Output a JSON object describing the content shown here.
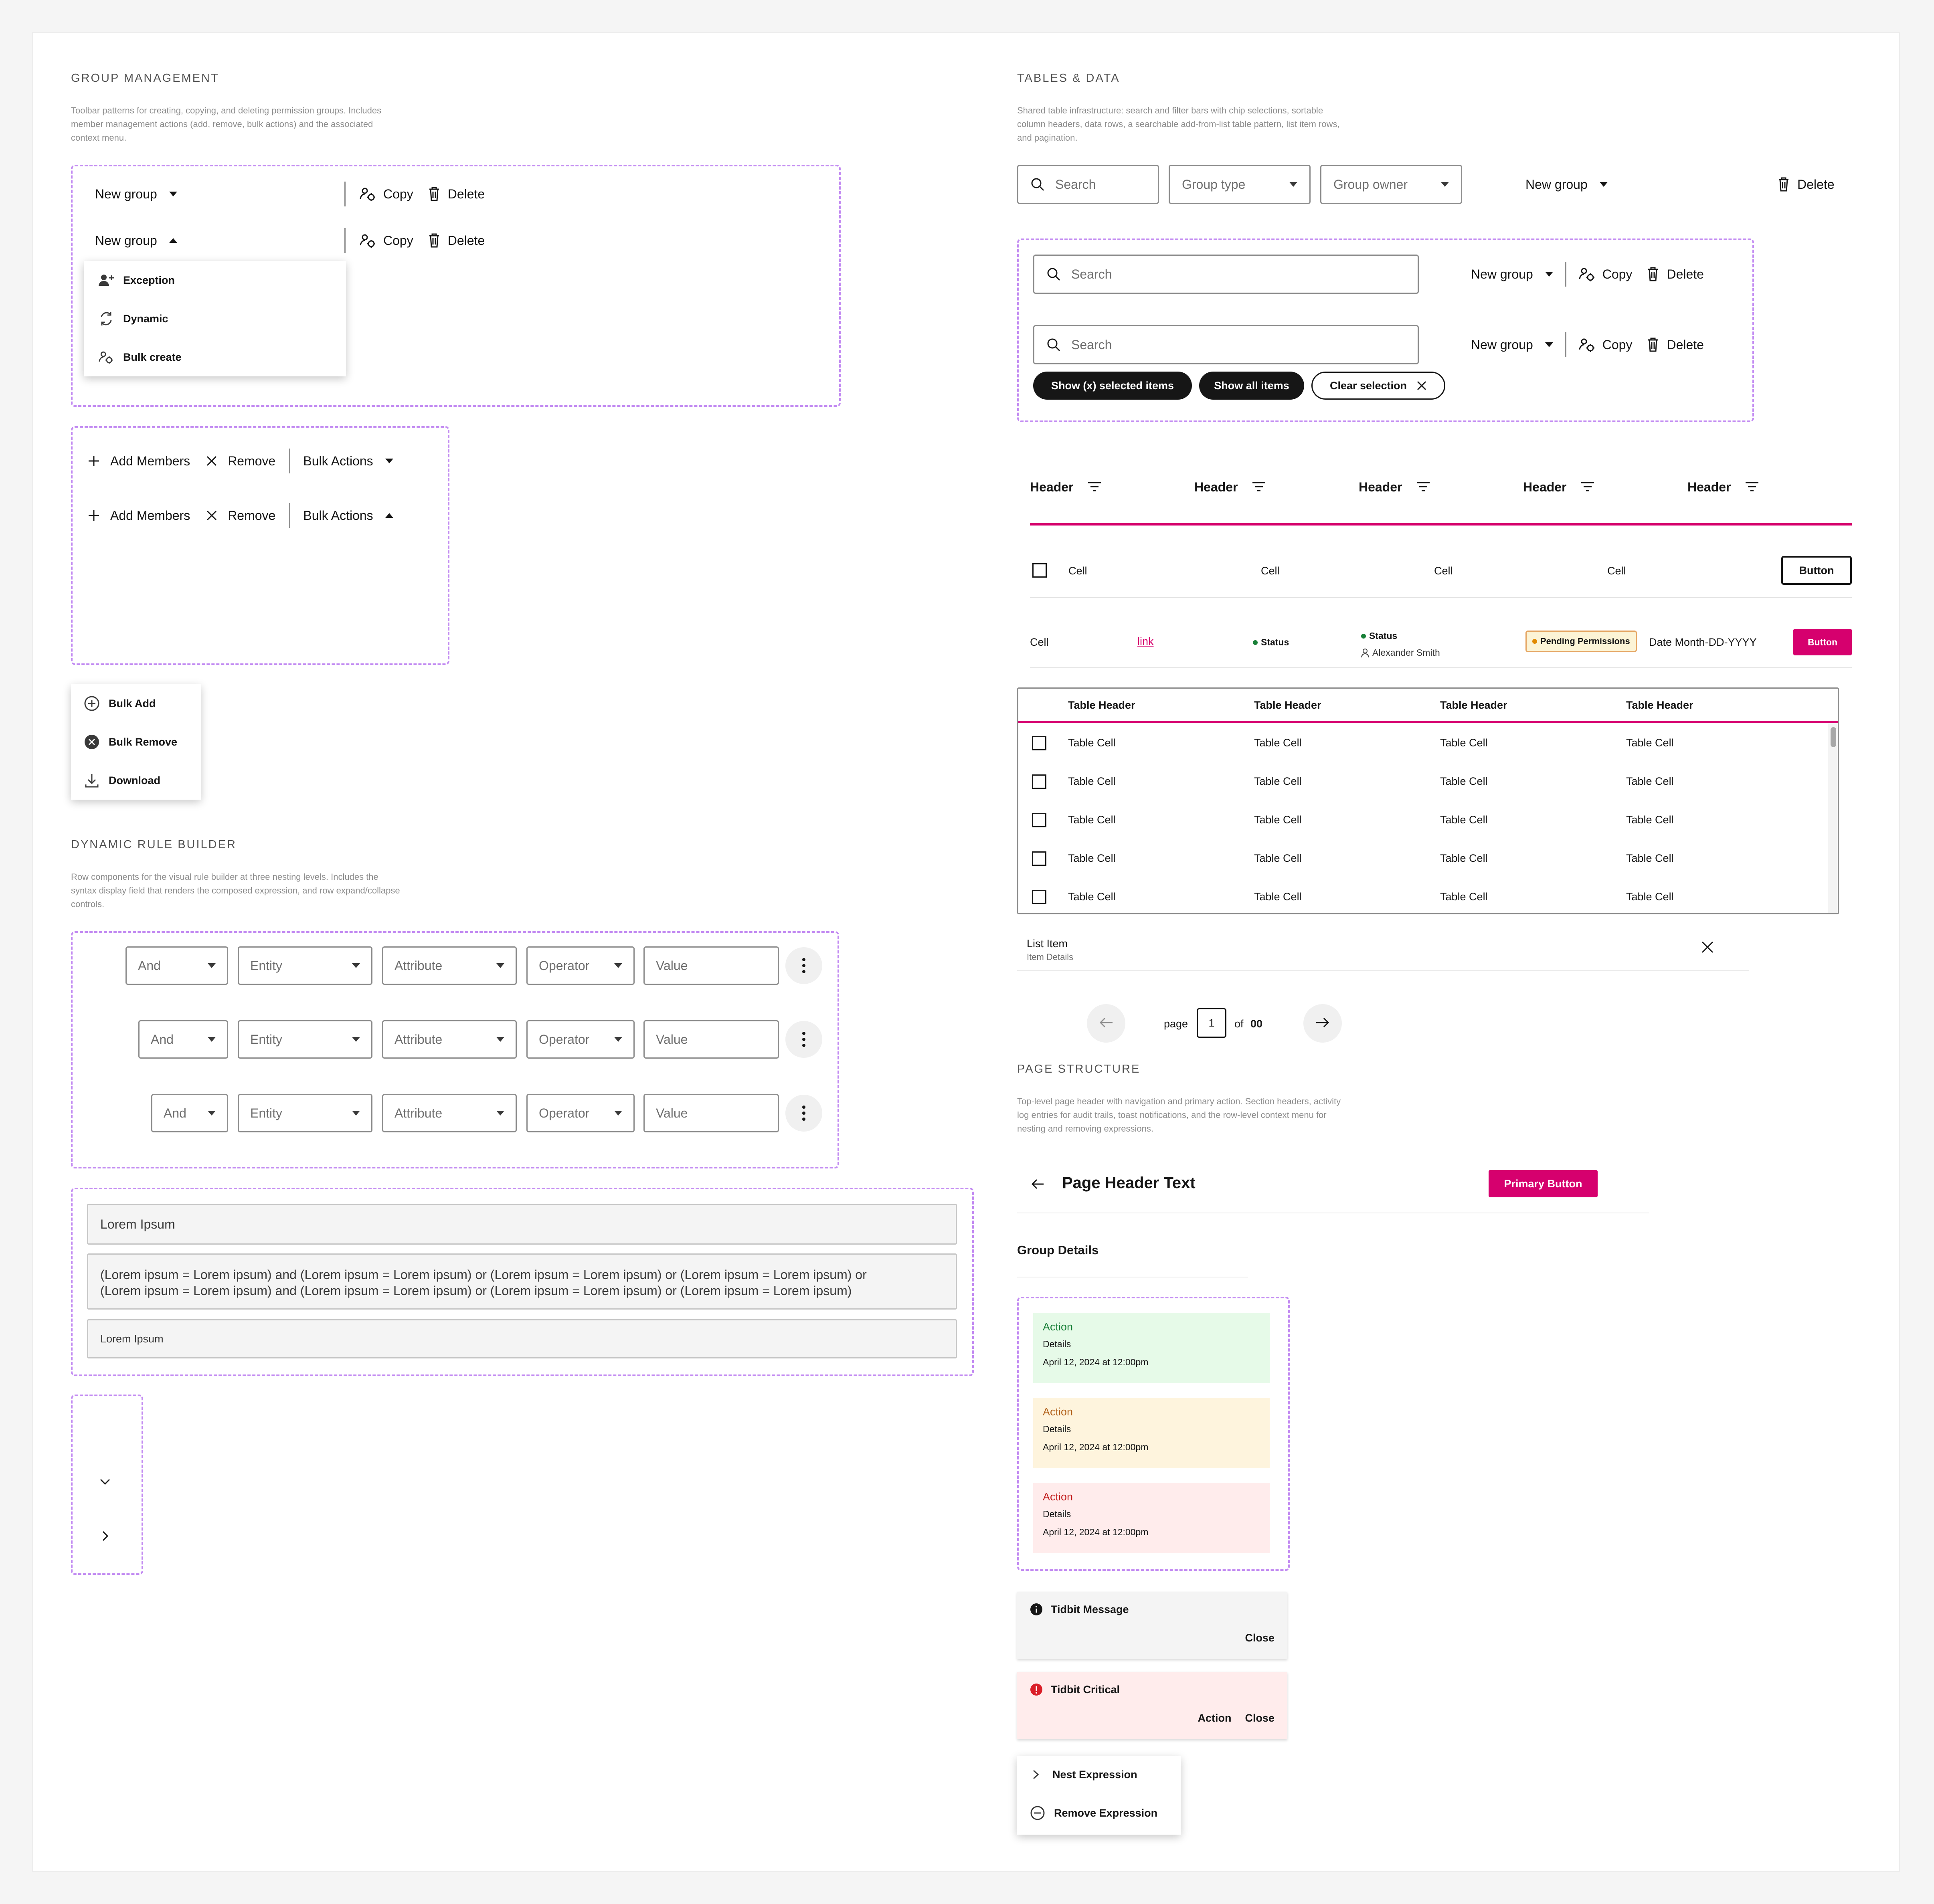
{
  "group_management": {
    "title": "GROUP MANAGEMENT",
    "desc_lines": [
      "Toolbar patterns for creating, copying, and deleting permission groups. Includes",
      "member management actions (add, remove, bulk actions) and the associated",
      "context menu."
    ],
    "new_group": "New group",
    "copy": "Copy",
    "delete": "Delete",
    "menu": [
      "Exception",
      "Dynamic",
      "Bulk create"
    ],
    "add_members": "Add Members",
    "remove": "Remove",
    "bulk_actions": "Bulk Actions",
    "bulk_menu": [
      "Bulk Add",
      "Bulk Remove",
      "Download"
    ]
  },
  "rule_builder": {
    "title": "DYNAMIC RULE BUILDER",
    "desc_lines": [
      "Row components for the visual rule builder at three nesting levels. Includes the",
      "syntax display field that renders the composed expression, and row expand/collapse",
      "controls."
    ],
    "and": "And",
    "entity": "Entity",
    "attribute": "Attribute",
    "operator": "Operator",
    "value": "Value",
    "syntax_title": "Lorem Ipsum",
    "syntax_line1": "(Lorem ipsum = Lorem ipsum) and (Lorem ipsum = Lorem ipsum) or (Lorem ipsum = Lorem ipsum) or (Lorem ipsum = Lorem ipsum)  or",
    "syntax_line2": "(Lorem ipsum = Lorem ipsum) and (Lorem ipsum = Lorem ipsum) or (Lorem ipsum = Lorem ipsum) or (Lorem ipsum = Lorem ipsum)",
    "syntax_small": "Lorem Ipsum"
  },
  "tables": {
    "title": "TABLES & DATA",
    "desc_lines": [
      "Shared table infrastructure: search and filter bars with chip selections, sortable",
      "column headers, data rows, a searchable add-from-list table pattern, list item rows,",
      "and pagination."
    ],
    "search": "Search",
    "group_type": "Group type",
    "group_owner": "Group owner",
    "new_group": "New group",
    "copy": "Copy",
    "delete": "Delete",
    "chip_selected": "Show (x) selected items",
    "chip_all": "Show all items",
    "chip_clear": "Clear selection",
    "header": "Header",
    "cell": "Cell",
    "button": "Button",
    "link": "link",
    "status": "Status",
    "person": "Alexander Smith",
    "pending": "Pending Permissions",
    "date": "Date Month-DD-YYYY",
    "table_header": "Table Header",
    "table_cell": "Table Cell",
    "list_item": "List Item",
    "item_details": "Item Details",
    "page_label": "page",
    "page_value": "1",
    "of_label": "of",
    "total_pages": "00",
    "colors": {
      "accent": "#d6006e",
      "status_green": "#198038",
      "pending_bg": "#fcf4d6",
      "pending_border": "#e5a663"
    }
  },
  "page_structure": {
    "title": "PAGE STRUCTURE",
    "desc_lines": [
      "Top-level page header with navigation and primary action. Section headers, activity",
      "log entries for audit trails, toast notifications, and the row-level context menu for",
      "nesting and removing expressions."
    ],
    "page_header": "Page Header Text",
    "primary_button": "Primary Button",
    "group_details": "Group Details",
    "activity": [
      {
        "action": "Action",
        "details": "Details",
        "time": "April 12, 2024 at 12:00pm",
        "bg": "#e6fae8",
        "fg": "#198038"
      },
      {
        "action": "Action",
        "details": "Details",
        "time": "April 12, 2024 at 12:00pm",
        "bg": "#fef4dd",
        "fg": "#b2621b"
      },
      {
        "action": "Action",
        "details": "Details",
        "time": "April 12, 2024 at 12:00pm",
        "bg": "#ffecec",
        "fg": "#c21d1d"
      }
    ],
    "tidbit_message": "Tidbit Message",
    "tidbit_critical": "Tidbit Critical",
    "close": "Close",
    "action": "Action",
    "nest_expression": "Nest Expression",
    "remove_expression": "Remove Expression"
  }
}
